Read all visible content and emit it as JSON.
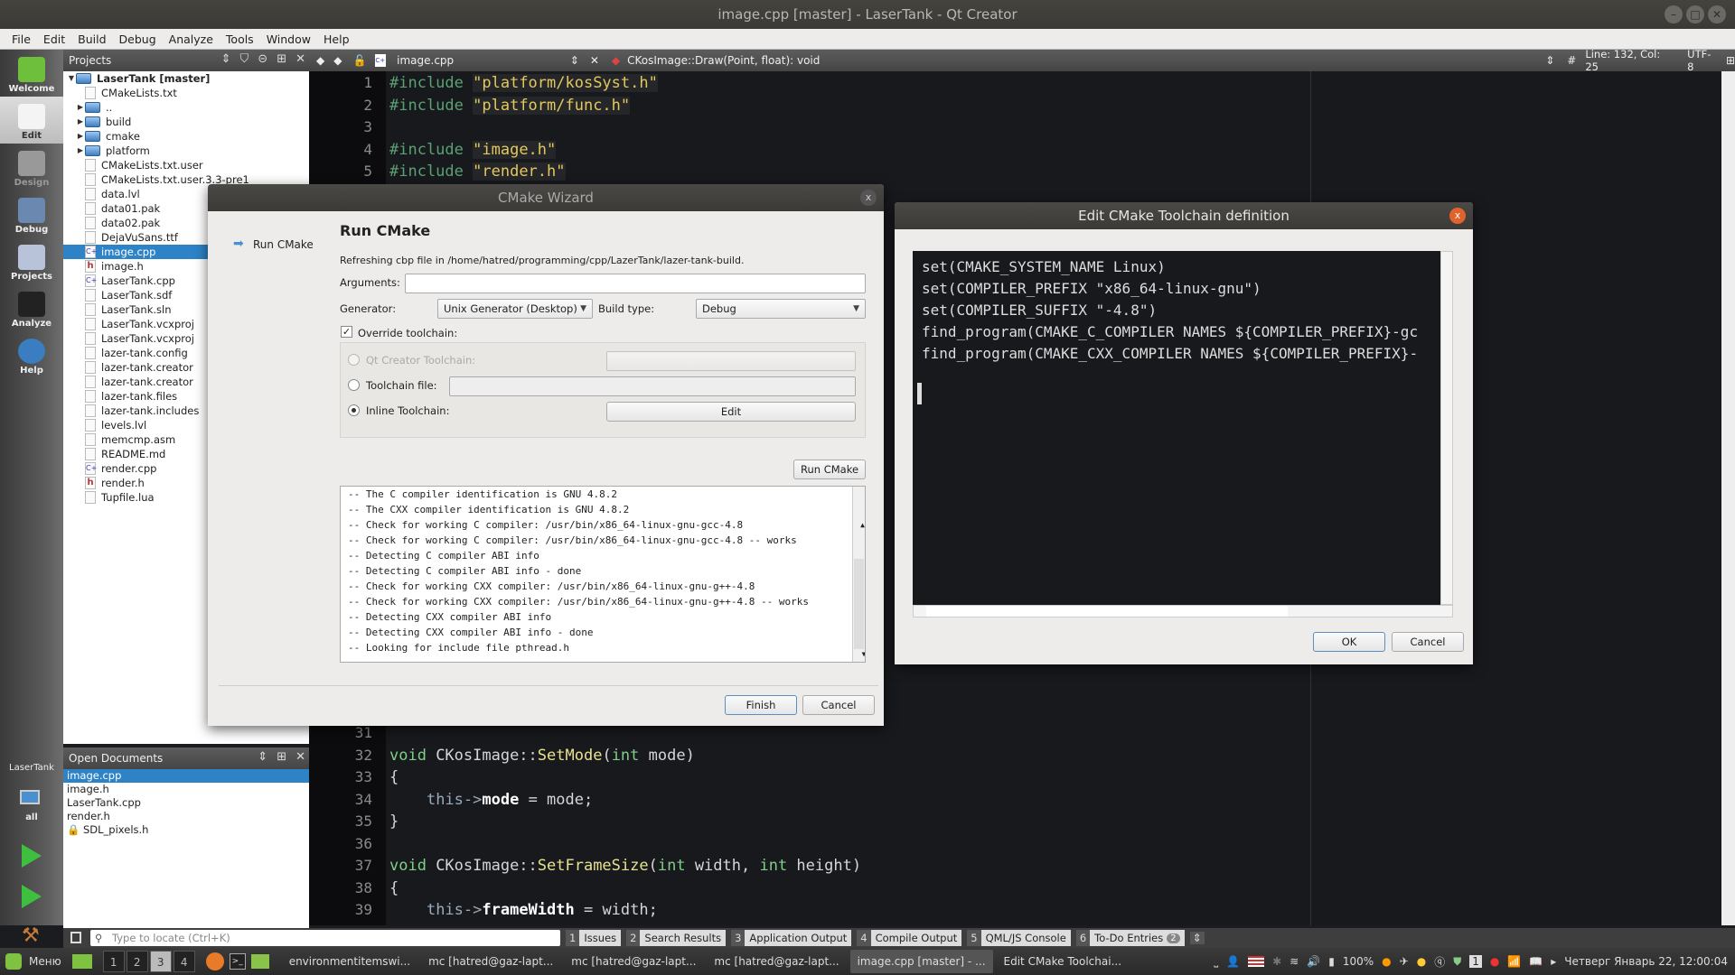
{
  "window": {
    "title": "image.cpp [master] - LaserTank - Qt Creator"
  },
  "menu": [
    "File",
    "Edit",
    "Build",
    "Debug",
    "Analyze",
    "Tools",
    "Window",
    "Help"
  ],
  "modes": [
    {
      "label": "Welcome",
      "icon": "qt-logo-icon"
    },
    {
      "label": "Edit",
      "icon": "edit-document-icon"
    },
    {
      "label": "Design",
      "icon": "design-tools-icon"
    },
    {
      "label": "Debug",
      "icon": "bug-icon"
    },
    {
      "label": "Projects",
      "icon": "projects-folder-icon"
    },
    {
      "label": "Analyze",
      "icon": "oscilloscope-icon"
    },
    {
      "label": "Help",
      "icon": "help-icon"
    }
  ],
  "kit": {
    "project": "LaserTank",
    "config": "all"
  },
  "projects": {
    "header": "Projects",
    "root": "LaserTank [master]",
    "items": [
      {
        "name": "CMakeLists.txt",
        "type": "file"
      },
      {
        "name": "..",
        "type": "folder"
      },
      {
        "name": "build",
        "type": "folder"
      },
      {
        "name": "cmake",
        "type": "folder"
      },
      {
        "name": "platform",
        "type": "folder"
      },
      {
        "name": "CMakeLists.txt.user",
        "type": "file"
      },
      {
        "name": "CMakeLists.txt.user.3.3-pre1",
        "type": "file"
      },
      {
        "name": "data.lvl",
        "type": "file"
      },
      {
        "name": "data01.pak",
        "type": "file"
      },
      {
        "name": "data02.pak",
        "type": "file"
      },
      {
        "name": "DejaVuSans.ttf",
        "type": "file"
      },
      {
        "name": "image.cpp",
        "type": "cpp",
        "selected": true
      },
      {
        "name": "image.h",
        "type": "h"
      },
      {
        "name": "LaserTank.cpp",
        "type": "cpp"
      },
      {
        "name": "LaserTank.sdf",
        "type": "file"
      },
      {
        "name": "LaserTank.sln",
        "type": "file"
      },
      {
        "name": "LaserTank.vcxproj",
        "type": "file"
      },
      {
        "name": "LaserTank.vcxproj",
        "type": "file"
      },
      {
        "name": "lazer-tank.config",
        "type": "file"
      },
      {
        "name": "lazer-tank.creator",
        "type": "file"
      },
      {
        "name": "lazer-tank.creator",
        "type": "file"
      },
      {
        "name": "lazer-tank.files",
        "type": "file"
      },
      {
        "name": "lazer-tank.includes",
        "type": "file"
      },
      {
        "name": "levels.lvl",
        "type": "file"
      },
      {
        "name": "memcmp.asm",
        "type": "file"
      },
      {
        "name": "README.md",
        "type": "file"
      },
      {
        "name": "render.cpp",
        "type": "cpp"
      },
      {
        "name": "render.h",
        "type": "h"
      },
      {
        "name": "Tupfile.lua",
        "type": "file"
      }
    ]
  },
  "open_documents": {
    "header": "Open Documents",
    "items": [
      "image.cpp",
      "image.h",
      "LaserTank.cpp",
      "render.h",
      "SDL_pixels.h"
    ]
  },
  "editor": {
    "file": "image.cpp",
    "symbol": "CKosImage::Draw(Point, float): void",
    "position": "Line: 132, Col: 25",
    "encoding": "UTF-8",
    "lines_top": [
      {
        "n": "1",
        "code": "#include \"platform/kosSyst.h\""
      },
      {
        "n": "2",
        "code": "#include \"platform/func.h\""
      },
      {
        "n": "3",
        "code": ""
      },
      {
        "n": "4",
        "code": "#include \"image.h\""
      },
      {
        "n": "5",
        "code": "#include \"render.h\""
      }
    ],
    "lines_bottom": [
      {
        "n": "31",
        "code": ""
      },
      {
        "n": "32",
        "code": "void CKosImage::SetMode(int mode)"
      },
      {
        "n": "33",
        "code": "{"
      },
      {
        "n": "34",
        "code": "    this->mode = mode;"
      },
      {
        "n": "35",
        "code": "}"
      },
      {
        "n": "36",
        "code": ""
      },
      {
        "n": "37",
        "code": "void CKosImage::SetFrameSize(int width, int height)"
      },
      {
        "n": "38",
        "code": "{"
      },
      {
        "n": "39",
        "code": "    this->frameWidth = width;"
      }
    ]
  },
  "cmake_wizard": {
    "title": "CMake Wizard",
    "step": "Run CMake",
    "heading": "Run CMake",
    "description": "Refreshing cbp file in /home/hatred/programming/cpp/LazerTank/lazer-tank-build.",
    "arguments_label": "Arguments:",
    "arguments_value": "",
    "generator_label": "Generator:",
    "generator_value": "Unix Generator (Desktop)",
    "build_type_label": "Build type:",
    "build_type_value": "Debug",
    "override_label": "Override toolchain:",
    "override_checked": true,
    "qt_toolchain_label": "Qt Creator Toolchain:",
    "toolchain_file_label": "Toolchain file:",
    "toolchain_file_value": "",
    "inline_label": "Inline Toolchain:",
    "edit_button": "Edit",
    "run_button": "Run CMake",
    "log": [
      "-- The C compiler identification is GNU 4.8.2",
      "-- The CXX compiler identification is GNU 4.8.2",
      "-- Check for working C compiler: /usr/bin/x86_64-linux-gnu-gcc-4.8",
      "-- Check for working C compiler: /usr/bin/x86_64-linux-gnu-gcc-4.8 -- works",
      "-- Detecting C compiler ABI info",
      "-- Detecting C compiler ABI info - done",
      "-- Check for working CXX compiler: /usr/bin/x86_64-linux-gnu-g++-4.8",
      "-- Check for working CXX compiler: /usr/bin/x86_64-linux-gnu-g++-4.8 -- works",
      "-- Detecting CXX compiler ABI info",
      "-- Detecting CXX compiler ABI info - done",
      "-- Looking for include file pthread.h"
    ],
    "finish_button": "Finish",
    "cancel_button": "Cancel"
  },
  "toolchain_dialog": {
    "title": "Edit CMake Toolchain definition",
    "lines": [
      "set(CMAKE_SYSTEM_NAME Linux)",
      "set(COMPILER_PREFIX \"x86_64-linux-gnu\")",
      "set(COMPILER_SUFFIX \"-4.8\")",
      "find_program(CMAKE_C_COMPILER NAMES ${COMPILER_PREFIX}-gc",
      "find_program(CMAKE_CXX_COMPILER NAMES ${COMPILER_PREFIX}-"
    ],
    "ok_button": "OK",
    "cancel_button": "Cancel"
  },
  "output_bar": {
    "locate_placeholder": "Type to locate (Ctrl+K)",
    "tabs": [
      {
        "n": "1",
        "label": "Issues"
      },
      {
        "n": "2",
        "label": "Search Results"
      },
      {
        "n": "3",
        "label": "Application Output"
      },
      {
        "n": "4",
        "label": "Compile Output"
      },
      {
        "n": "5",
        "label": "QML/JS Console"
      },
      {
        "n": "6",
        "label": "To-Do Entries",
        "badge": "2"
      }
    ]
  },
  "taskbar": {
    "menu_label": "Меню",
    "workspaces": [
      "1",
      "2",
      "3",
      "4"
    ],
    "active_workspace": "3",
    "windows": [
      {
        "label": "environmentitemswi...",
        "active": false
      },
      {
        "label": "mc [hatred@gaz-lapt...",
        "active": false
      },
      {
        "label": "mc [hatred@gaz-lapt...",
        "active": false
      },
      {
        "label": "mc [hatred@gaz-lapt...",
        "active": false
      },
      {
        "label": "image.cpp [master] - ...",
        "active": true
      },
      {
        "label": "Edit CMake Toolchai...",
        "active": false
      }
    ],
    "battery": "100%",
    "clock": "Четверг Январь 22, 12:00:04"
  }
}
